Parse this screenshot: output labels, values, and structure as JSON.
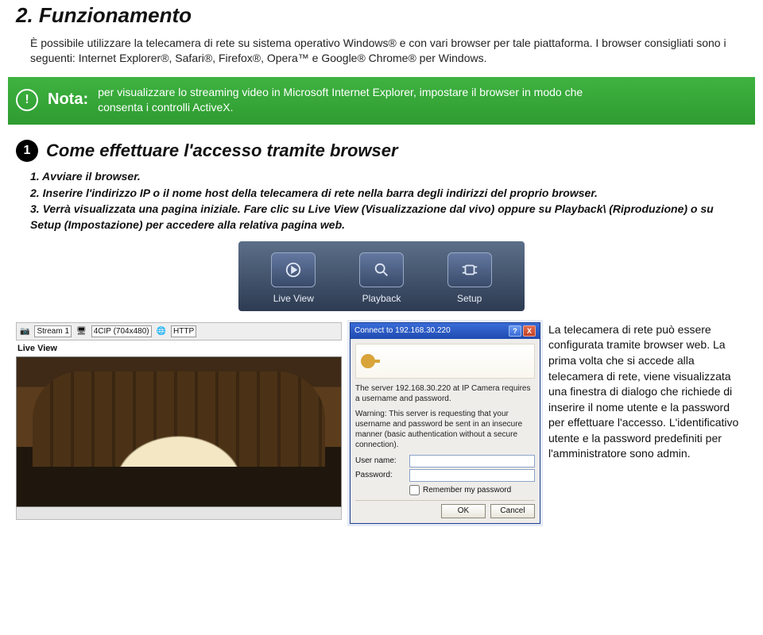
{
  "heading": "2. Funzionamento",
  "intro": "È possibile utilizzare la telecamera di rete su sistema operativo Windows® e con vari browser per tale piattaforma. I browser consigliati sono i seguenti: Internet Explorer®, Safari®, Firefox®, Opera™ e Google® Chrome® per Windows.",
  "note": {
    "icon": "!",
    "label": "Nota:",
    "text": "per visualizzare lo streaming video in Microsoft Internet Explorer, impostare il browser in modo che consenta i controlli ActiveX."
  },
  "step1": {
    "num": "1",
    "title": "Come effettuare l'accesso tramite browser",
    "items": [
      "1. Avviare il browser.",
      "2. Inserire l'indirizzo IP o il nome host della telecamera di rete nella barra degli indirizzi del proprio browser.",
      "3. Verrà visualizzata una pagina iniziale. Fare clic su Live View (Visualizzazione dal vivo) oppure su Playback\\ (Riproduzione) o su Setup (Impostazione) per accedere alla relativa pagina web."
    ]
  },
  "tabs": [
    {
      "label": "Live View"
    },
    {
      "label": "Playback"
    },
    {
      "label": "Setup"
    }
  ],
  "liveview_toolbar": {
    "stream": "Stream 1",
    "res": "4CIP (704x480)",
    "proto": "HTTP"
  },
  "liveview_title": "Live View",
  "dialog": {
    "title": "Connect to 192.168.30.220",
    "help": "?",
    "close": "X",
    "server_line": "The server 192.168.30.220 at IP Camera requires a username and password.",
    "warn": "Warning: This server is requesting that your username and password be sent in an insecure manner (basic authentication without a secure connection).",
    "user_label": "User name:",
    "user_value": "",
    "user_placeholder": "",
    "pass_label": "Password:",
    "remember": "Remember my password",
    "ok": "OK",
    "cancel": "Cancel"
  },
  "right_text": "La telecamera di rete può essere configurata tramite browser web. La prima volta che si accede alla telecamera di rete, viene visualizzata una finestra di dialogo che richiede di inserire il nome utente e la password per effettuare l'accesso. L'identificativo utente e la password predefiniti per l'amministratore sono admin."
}
